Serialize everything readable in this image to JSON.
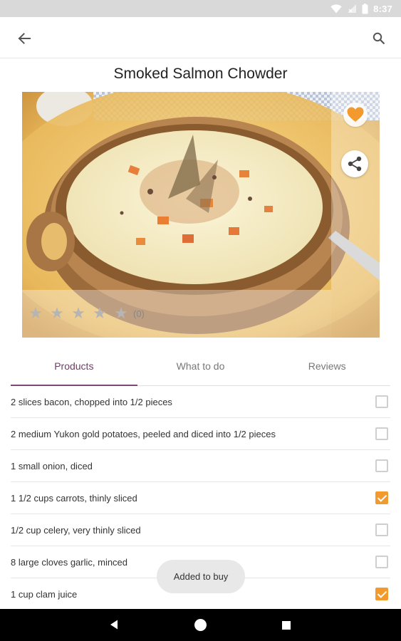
{
  "status_bar": {
    "time": "8:37"
  },
  "recipe": {
    "title": "Smoked Salmon Chowder",
    "rating_count": "(0)",
    "stars": [
      "★",
      "★",
      "★",
      "★",
      "★"
    ]
  },
  "tabs": [
    {
      "label": "Products",
      "active": true
    },
    {
      "label": "What to do",
      "active": false
    },
    {
      "label": "Reviews",
      "active": false
    }
  ],
  "ingredients": [
    {
      "text": "2 slices bacon, chopped into 1/2 pieces",
      "checked": false
    },
    {
      "text": "2 medium Yukon gold potatoes, peeled and diced into 1/2 pieces",
      "checked": false
    },
    {
      "text": "1 small onion, diced",
      "checked": false
    },
    {
      "text": "1 1/2 cups carrots, thinly sliced",
      "checked": true
    },
    {
      "text": "1/2 cup celery, very thinly sliced",
      "checked": false
    },
    {
      "text": "8 large cloves garlic, minced",
      "checked": false
    },
    {
      "text": "1 cup clam juice",
      "checked": true
    }
  ],
  "toast": {
    "message": "Added to buy"
  },
  "colors": {
    "accent": "#f29a2e",
    "tab_active": "#6b3f63",
    "heart": "#f29a2e"
  },
  "icons": {
    "back": "arrow-left-icon",
    "search": "search-icon",
    "favorite": "heart-icon",
    "share": "share-icon"
  }
}
